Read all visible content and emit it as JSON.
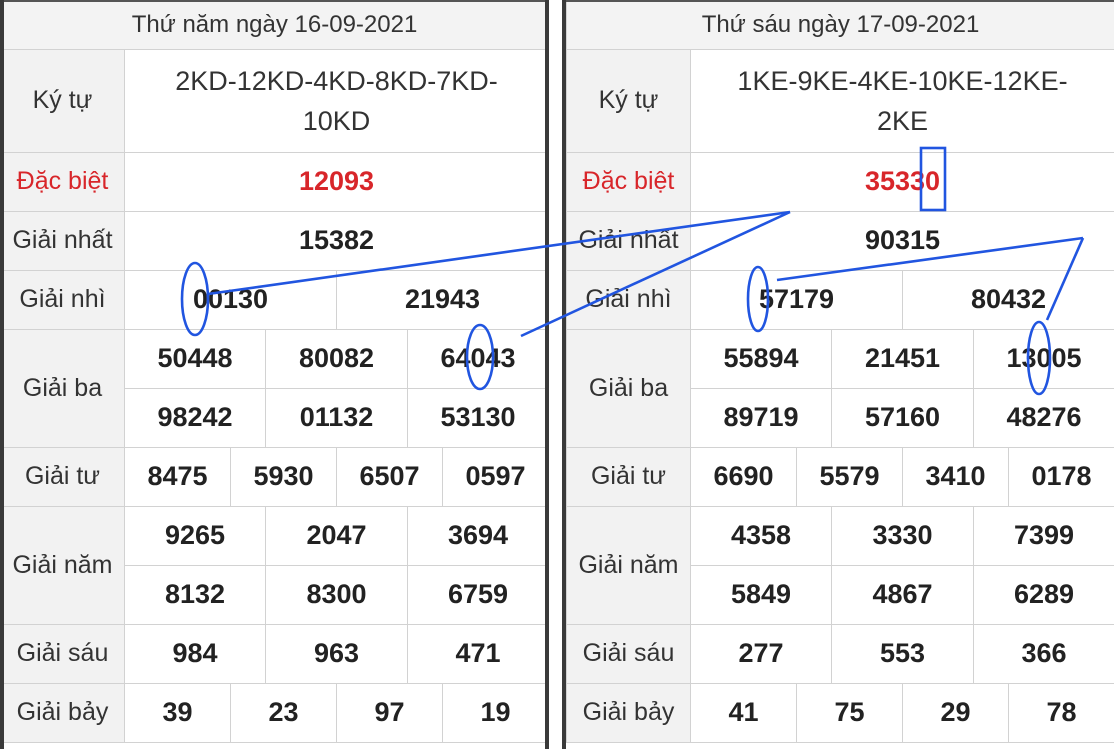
{
  "left": {
    "header": "Thứ năm ngày 16-09-2021",
    "labels": {
      "kytu": "Ký tự",
      "dacbiet": "Đặc biệt",
      "nhat": "Giải nhất",
      "nhi": "Giải nhì",
      "ba": "Giải ba",
      "tu": "Giải tư",
      "nam": "Giải năm",
      "sau": "Giải sáu",
      "bay": "Giải bảy"
    },
    "kytu": "2KD-12KD-4KD-8KD-7KD-10KD",
    "dacbiet": "12093",
    "nhat": "15382",
    "nhi": [
      "00130",
      "21943"
    ],
    "ba": [
      "50448",
      "80082",
      "64043",
      "98242",
      "01132",
      "53130"
    ],
    "tu": [
      "8475",
      "5930",
      "6507",
      "0597"
    ],
    "nam": [
      "9265",
      "2047",
      "3694",
      "8132",
      "8300",
      "6759"
    ],
    "sau": [
      "984",
      "963",
      "471"
    ],
    "bay": [
      "39",
      "23",
      "97",
      "19"
    ]
  },
  "right": {
    "header": "Thứ sáu ngày 17-09-2021",
    "labels": {
      "kytu": "Ký tự",
      "dacbiet": "Đặc biệt",
      "nhat": "Giải nhất",
      "nhi": "Giải nhì",
      "ba": "Giải ba",
      "tu": "Giải tư",
      "nam": "Giải năm",
      "sau": "Giải sáu",
      "bay": "Giải bảy"
    },
    "kytu": "1KE-9KE-4KE-10KE-12KE-2KE",
    "dacbiet": "35330",
    "nhat": "90315",
    "nhi": [
      "57179",
      "80432"
    ],
    "ba": [
      "55894",
      "21451",
      "13005",
      "89719",
      "57160",
      "48276"
    ],
    "tu": [
      "6690",
      "5579",
      "3410",
      "0178"
    ],
    "nam": [
      "4358",
      "3330",
      "7399",
      "5849",
      "4867",
      "6289"
    ],
    "sau": [
      "277",
      "553",
      "366"
    ],
    "bay": [
      "41",
      "75",
      "29",
      "78"
    ]
  },
  "colors": {
    "special": "#d8262a",
    "annotation": "#2155e0",
    "label_bg": "#f2f2f2"
  }
}
